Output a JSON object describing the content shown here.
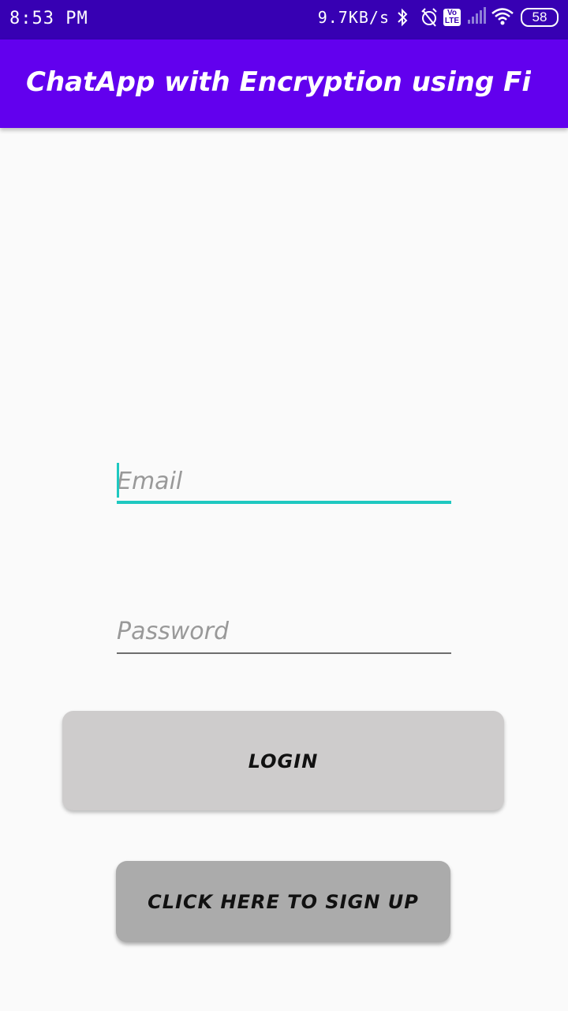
{
  "status_bar": {
    "time": "8:53 PM",
    "net_speed": "9.7KB/s",
    "volte_label": "Vo\nLTE",
    "battery": "58",
    "icons": [
      "bluetooth-icon",
      "alarm-off-icon",
      "volte-icon",
      "signal-icon",
      "wifi-icon",
      "battery-icon"
    ]
  },
  "app_bar": {
    "title": "ChatApp with Encryption using Fireb…"
  },
  "form": {
    "email_placeholder": "Email",
    "email_value": "",
    "password_placeholder": "Password",
    "password_value": ""
  },
  "buttons": {
    "login_label": "LOGIN",
    "signup_label": "CLICK HERE TO SIGN UP"
  },
  "colors": {
    "status_bar": "#3700b3",
    "app_bar": "#6200ee",
    "accent": "#1ec8c0",
    "login_button": "#cecccc",
    "signup_button": "#ababab",
    "background": "#fafafa"
  }
}
